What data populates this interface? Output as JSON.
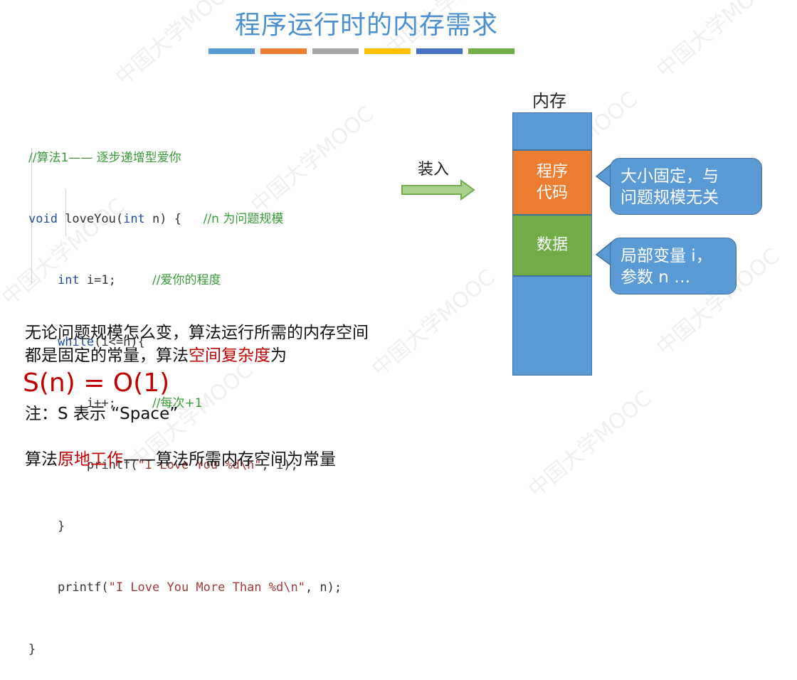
{
  "title": "程序运行时的内存需求",
  "color_bars": [
    "#5b9bd5",
    "#ed7d31",
    "#a5a5a5",
    "#ffc000",
    "#4472c4",
    "#70ad47"
  ],
  "code": {
    "line1_comment": "//算法1—— 逐步递增型爱你",
    "line2_kw_void": "void",
    "line2_fn": " loveYou(",
    "line2_kw_int": "int",
    "line2_rest": " n) {",
    "line2_comment": "//n 为问题规模",
    "line3_kw_int": "int",
    "line3_rest": " i=1;",
    "line3_comment": "//爱你的程度",
    "line4_kw_while": "while",
    "line4_rest": "(i<=n){",
    "line5_code": "i++;",
    "line5_comment": "//每次+1",
    "line6_fn": "printf(",
    "line6_str": "\"I Love You %d\\n\"",
    "line6_rest": ", i);",
    "line7_code": "}",
    "line8_fn": "printf(",
    "line8_str": "\"I Love You More Than %d\\n\"",
    "line8_rest": ", n);",
    "line9_code": "}"
  },
  "load_label": "装入",
  "memory": {
    "label": "内存",
    "block_code": "程序\n代码",
    "block_data": "数据",
    "colors": {
      "top": "#5b9bd5",
      "code": "#ed7d31",
      "data": "#70ad47",
      "bottom": "#5b9bd5"
    }
  },
  "callouts": {
    "code_note": "大小固定，与\n问题规模无关",
    "data_note": "局部变量 i，\n参数 n …"
  },
  "text": {
    "para1_line1": "无论问题规模怎么变，算法运行所需的内存空间",
    "para1_line2_a": "都是固定的常量，算法",
    "para1_line2_b": "空间复杂度",
    "para1_line2_c": "为",
    "formula": "S(n) = O(1)",
    "note": "注：S 表示 “Space”",
    "para2_a": "算法",
    "para2_b": "原地工作",
    "para2_c": "——算法所需内存空间为常量"
  },
  "watermark": "中国大学MOOC"
}
